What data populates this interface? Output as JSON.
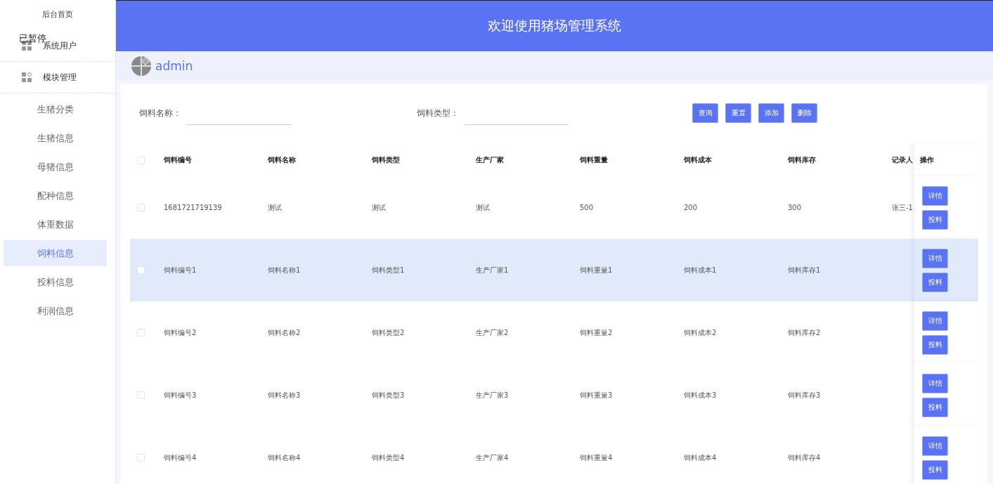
{
  "sidebar": {
    "home": "后台首页",
    "overlay_text": "已暂停",
    "groups": [
      {
        "label": "系统用户",
        "expanded": false
      },
      {
        "label": "模块管理",
        "expanded": true,
        "children": [
          {
            "label": "生猪分类",
            "selected": false
          },
          {
            "label": "生猪信息",
            "selected": false
          },
          {
            "label": "母猪信息",
            "selected": false
          },
          {
            "label": "配种信息",
            "selected": false
          },
          {
            "label": "体重数据",
            "selected": false
          },
          {
            "label": "饲料信息",
            "selected": true
          },
          {
            "label": "投料信息",
            "selected": false
          },
          {
            "label": "利润信息",
            "selected": false
          }
        ]
      }
    ]
  },
  "header": {
    "title": "欢迎使用猪场管理系统"
  },
  "user": {
    "name": "admin"
  },
  "filters": [
    {
      "label": "饲料名称："
    },
    {
      "label": "饲料类型："
    }
  ],
  "buttons": [
    "查询",
    "重置",
    "添加",
    "删除"
  ],
  "table": {
    "all_checked": false,
    "columns": [
      "饲料编号",
      "饲料名称",
      "饲料类型",
      "生产厂家",
      "饲料重量",
      "饲料成本",
      "饲料库存",
      "记录人",
      "操作"
    ],
    "rows": [
      {
        "checked": false,
        "hovered": false,
        "cells": [
          "1681721719139",
          "测试",
          "测试",
          "测试",
          "500",
          "200",
          "300",
          "张三-1"
        ],
        "actions": [
          "详情",
          "投料"
        ]
      },
      {
        "checked": false,
        "hovered": true,
        "cells": [
          "饲料编号1",
          "饲料名称1",
          "饲料类型1",
          "生产厂家1",
          "饲料重量1",
          "饲料成本1",
          "饲料库存1",
          ""
        ],
        "actions": [
          "详情",
          "投料"
        ]
      },
      {
        "checked": false,
        "hovered": false,
        "cells": [
          "饲料编号2",
          "饲料名称2",
          "饲料类型2",
          "生产厂家2",
          "饲料重量2",
          "饲料成本2",
          "饲料库存2",
          ""
        ],
        "actions": [
          "详情",
          "投料"
        ]
      },
      {
        "checked": false,
        "hovered": false,
        "cells": [
          "饲料编号3",
          "饲料名称3",
          "饲料类型3",
          "生产厂家3",
          "饲料重量3",
          "饲料成本3",
          "饲料库存3",
          ""
        ],
        "actions": [
          "详情",
          "投料"
        ]
      },
      {
        "checked": false,
        "hovered": false,
        "cells": [
          "饲料编号4",
          "饲料名称4",
          "饲料类型4",
          "生产厂家4",
          "饲料重量4",
          "饲料成本4",
          "饲料库存4",
          ""
        ],
        "actions": [
          "详情",
          "投料"
        ]
      }
    ]
  }
}
